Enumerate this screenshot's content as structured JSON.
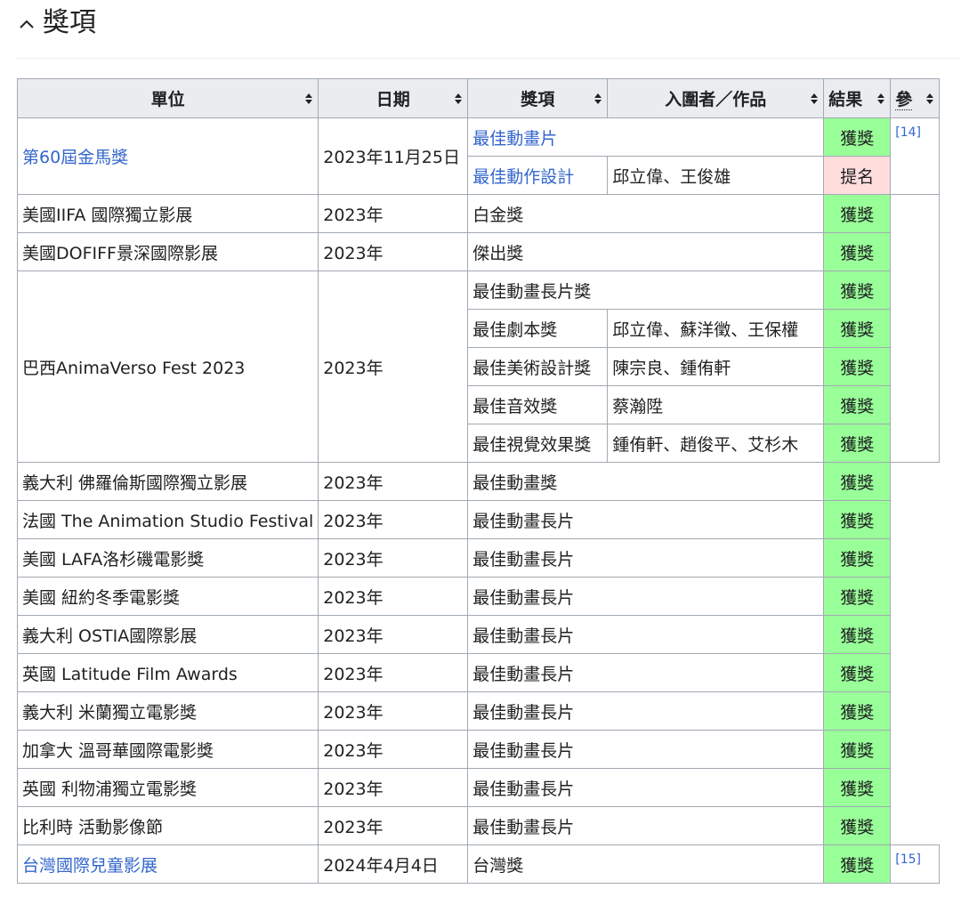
{
  "section": {
    "title": "獎項",
    "toggle_icon": "chevron-up-icon"
  },
  "table": {
    "headers": {
      "unit": "單位",
      "date": "日期",
      "award": "獎項",
      "nominee": "入圍者／作品",
      "result": "結果",
      "ref": "參"
    },
    "group_golden_horse": {
      "unit": "第60屆金馬獎",
      "date": "2023年11月25日",
      "ref": "[14]",
      "rows": [
        {
          "award": "最佳動畫片",
          "nominee": "",
          "result": "獲獎"
        },
        {
          "award": "最佳動作設計",
          "nominee": "邱立偉、王俊雄",
          "result": "提名"
        }
      ]
    },
    "row_iifa": {
      "unit": "美國IIFA 國際獨立影展",
      "date": "2023年",
      "award": "白金獎",
      "result": "獲獎"
    },
    "row_dofiff": {
      "unit": "美國DOFIFF景深國際影展",
      "date": "2023年",
      "award": "傑出獎",
      "result": "獲獎"
    },
    "group_animaverso": {
      "unit": "巴西AnimaVerso Fest 2023",
      "date": "2023年",
      "rows": [
        {
          "award": "最佳動畫長片獎",
          "nominee": "",
          "result": "獲獎"
        },
        {
          "award": "最佳劇本獎",
          "nominee": "邱立偉、蘇洋徵、王保權",
          "result": "獲獎"
        },
        {
          "award": "最佳美術設計獎",
          "nominee": "陳宗良、鍾侑軒",
          "result": "獲獎"
        },
        {
          "award": "最佳音效獎",
          "nominee": "蔡瀚陞",
          "result": "獲獎"
        },
        {
          "award": "最佳視覺效果獎",
          "nominee": "鍾侑軒、趙俊平、艾杉木",
          "result": "獲獎"
        }
      ]
    },
    "simple_rows": [
      {
        "unit": "義大利 佛羅倫斯國際獨立影展",
        "date": "2023年",
        "award": "最佳動畫獎",
        "result": "獲獎"
      },
      {
        "unit": "法國 The Animation Studio Festival",
        "date": "2023年",
        "award": "最佳動畫長片",
        "result": "獲獎"
      },
      {
        "unit": "美國 LAFA洛杉磯電影獎",
        "date": "2023年",
        "award": "最佳動畫長片",
        "result": "獲獎"
      },
      {
        "unit": "美國 紐約冬季電影獎",
        "date": "2023年",
        "award": "最佳動畫長片",
        "result": "獲獎"
      },
      {
        "unit": "義大利 OSTIA國際影展",
        "date": "2023年",
        "award": "最佳動畫長片",
        "result": "獲獎"
      },
      {
        "unit": "英國 Latitude Film Awards",
        "date": "2023年",
        "award": "最佳動畫長片",
        "result": "獲獎"
      },
      {
        "unit": "義大利 米蘭獨立電影獎",
        "date": "2023年",
        "award": "最佳動畫長片",
        "result": "獲獎"
      },
      {
        "unit": "加拿大 溫哥華國際電影獎",
        "date": "2023年",
        "award": "最佳動畫長片",
        "result": "獲獎"
      },
      {
        "unit": "英國 利物浦獨立電影獎",
        "date": "2023年",
        "award": "最佳動畫長片",
        "result": "獲獎"
      },
      {
        "unit": "比利時 活動影像節",
        "date": "2023年",
        "award": "最佳動畫長片",
        "result": "獲獎"
      }
    ],
    "row_taiwan": {
      "unit": "台灣國際兒童影展",
      "date": "2024年4月4日",
      "award": "台灣獎",
      "result": "獲獎",
      "ref": "[15]"
    }
  },
  "colors": {
    "win": "#99ff99",
    "nominated": "#ffdddd",
    "link": "#3366cc",
    "header_bg": "#eaecf0",
    "border": "#a2a9b1"
  }
}
